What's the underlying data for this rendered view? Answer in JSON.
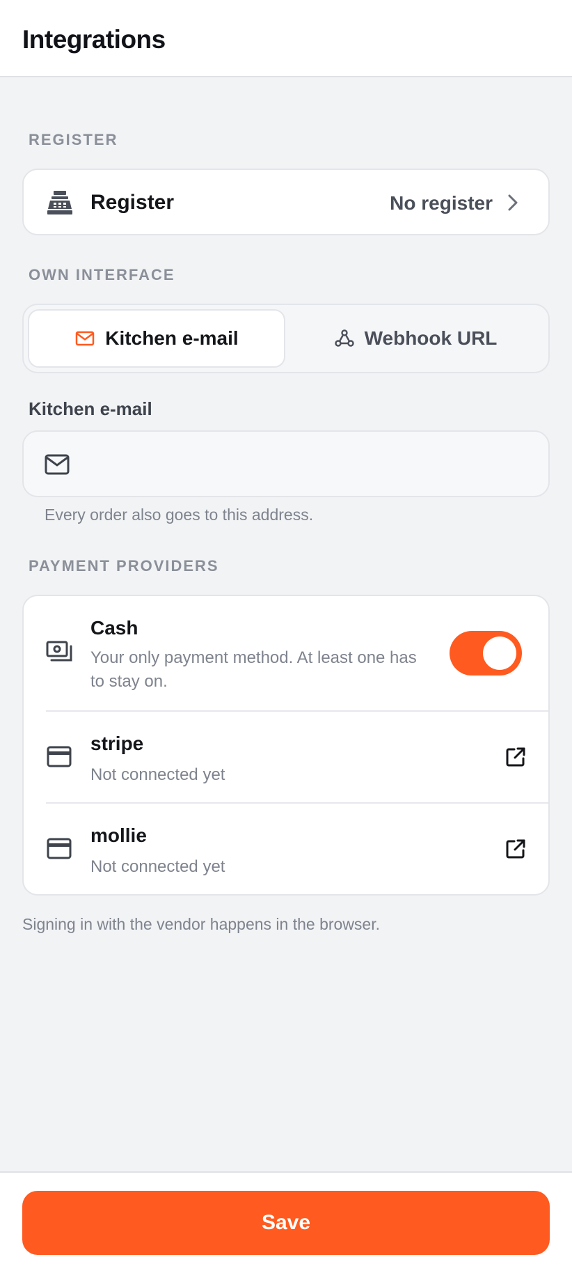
{
  "header": {
    "title": "Integrations"
  },
  "register_section": {
    "label": "REGISTER",
    "row_label": "Register",
    "row_value": "No register"
  },
  "own_interface": {
    "label": "OWN INTERFACE",
    "tabs": [
      {
        "label": "Kitchen e-mail",
        "icon": "mail-icon",
        "active": true
      },
      {
        "label": "Webhook URL",
        "icon": "webhook-icon",
        "active": false
      }
    ]
  },
  "kitchen_email": {
    "label": "Kitchen e-mail",
    "value": "",
    "helper": "Every order also goes to this address."
  },
  "payment_providers": {
    "label": "PAYMENT PROVIDERS",
    "items": [
      {
        "name": "Cash",
        "description": "Your only payment method. At least one has to stay on.",
        "enabled": true,
        "icon": "cash-icon"
      },
      {
        "name": "stripe",
        "description": "Not connected yet",
        "icon": "credit-card-icon"
      },
      {
        "name": "mollie",
        "description": "Not connected yet",
        "icon": "credit-card-icon"
      }
    ],
    "note": "Signing in with the vendor happens in the browser."
  },
  "actions": {
    "save_label": "Save"
  },
  "colors": {
    "accent": "#ff5a1f",
    "background": "#f2f3f5"
  }
}
